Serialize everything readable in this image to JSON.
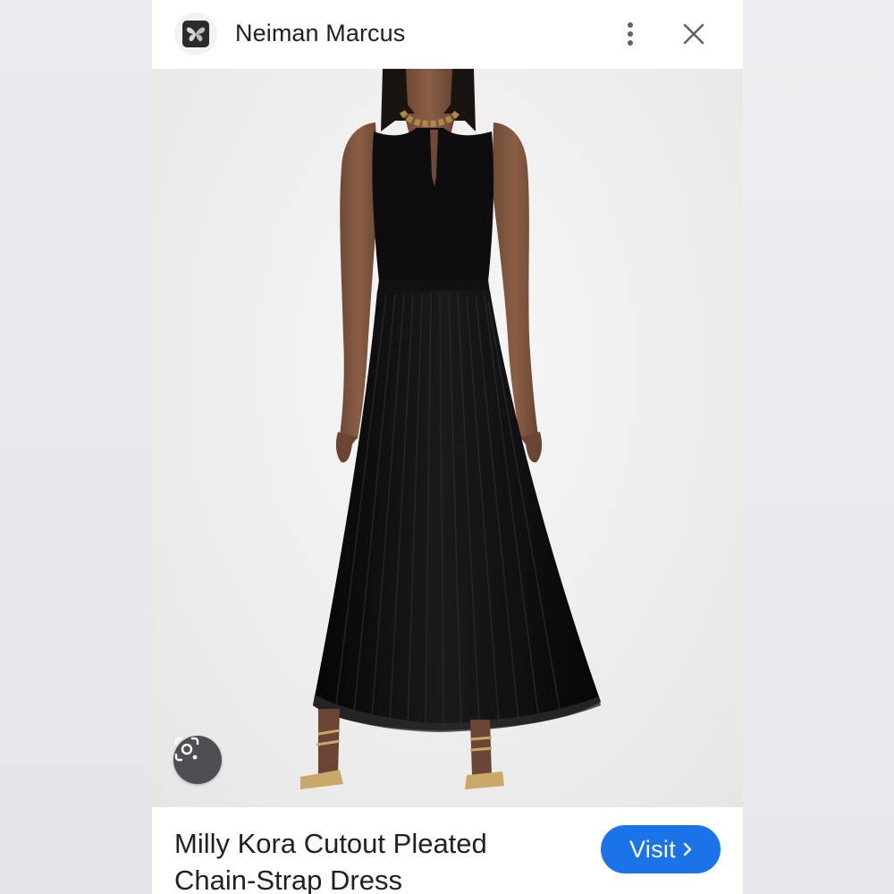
{
  "header": {
    "site_name": "Neiman Marcus",
    "logo_icon": "butterfly-icon",
    "more_icon": "more-vert-icon",
    "close_icon": "close-icon"
  },
  "image": {
    "lens_icon": "lens-search-icon"
  },
  "footer": {
    "product_title": "Milly Kora Cutout Pleated Chain-Strap Dress",
    "visit_label": "Visit",
    "visit_icon": "chevron-right-icon"
  },
  "colors": {
    "accent": "#1a73e8",
    "text": "#202124",
    "icon_gray": "#5f6368",
    "lens_button": "#4d4f53",
    "dress": "#0d0d0f"
  }
}
